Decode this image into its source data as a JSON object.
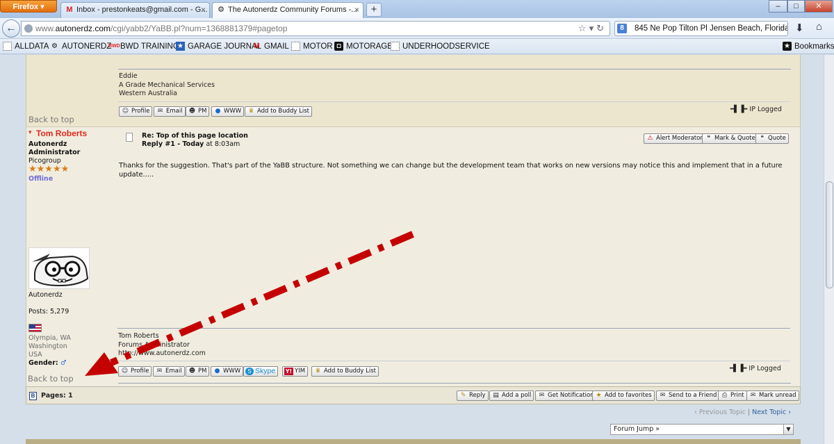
{
  "browser": {
    "menu_button": "Firefox ▾",
    "tabs": [
      {
        "label": "Inbox - prestonkeats@gmail.com - G...",
        "icon": "gmail-icon"
      },
      {
        "label": "The Autonerdz Community Forums -...",
        "icon": "autonerdz-icon"
      }
    ],
    "new_tab": "+",
    "window_buttons": {
      "minimize": "–",
      "maximize": "□",
      "close": "✕"
    },
    "url_prefix": "www.",
    "url_domain": "autonerdz.com",
    "url_path": "/cgi/yabb2/YaBB.pl?num=1368881379#pagetop",
    "search_text": "845 Ne Pop Tilton Pl Jensen Beach, Florida",
    "bookmarks_menu": "Bookmarks",
    "bookmarks": [
      {
        "label": "ALLDATA",
        "icon": "page-icon"
      },
      {
        "label": "AUTONERDZ",
        "icon": "autonerdz-icon"
      },
      {
        "label": "BWD TRAINING",
        "icon": "bwd-icon"
      },
      {
        "label": "GARAGE JOURNAL",
        "icon": "star-icon"
      },
      {
        "label": "GMAIL",
        "icon": "gmail-icon"
      },
      {
        "label": "MOTOR",
        "icon": "page-icon"
      },
      {
        "label": "MOTORAGE",
        "icon": "motorage-icon"
      },
      {
        "label": "UNDERHOODSERVICE",
        "icon": "page-icon"
      }
    ]
  },
  "previous_post": {
    "signature": "Eddie\nA Grade Mechanical Services\nWestern Australia",
    "back_to_top": "Back to top",
    "ip_logged": "IP Logged",
    "buttons": [
      "Profile",
      "Email",
      "PM",
      "WWW",
      "Add to Buddy List"
    ]
  },
  "post": {
    "author": "Tom Roberts",
    "author_title": "Autonerdz",
    "author_role": "Administrator",
    "group": "Picogroup",
    "stars": "★★★★★",
    "status": "Offline",
    "avatar_caption": "Autonerdz",
    "posts": "Posts: 5,279",
    "location": [
      "Olympia, WA",
      "Washington",
      "USA"
    ],
    "gender_label": "Gender:",
    "gender_symbol": "♂",
    "subject": "Re: Top of this page location",
    "reply_label": "Reply #1 - Today",
    "reply_time": " at 8:03am",
    "body": "Thanks for the suggestion.  That's part of the YaBB structure.  Not something we can change but the development team that works on new versions may notice this and implement that in a future update.....",
    "actions": [
      "Alert Moderator",
      "Mark & Quote",
      "Quote"
    ],
    "signature": "Tom Roberts\nForums Administrator\nhttp://www.autonerdz.com",
    "back_to_top": "Back to top",
    "ip_logged": "IP Logged",
    "buttons": [
      "Profile",
      "Email",
      "PM",
      "WWW",
      "Skype",
      "YIM",
      "Add to Buddy List"
    ]
  },
  "thread": {
    "pages_label": "Pages: 1",
    "actions": [
      "Reply",
      "Add a poll",
      "Get Notification",
      "Add to favorites",
      "Send to a Friend",
      "Print",
      "Mark unread"
    ],
    "prev_topic": "‹ Previous Topic",
    "separator": " | ",
    "next_topic": "Next Topic ›",
    "forum_jump": "Forum Jump »"
  },
  "colors": {
    "annotation_arrow": "#c40000",
    "author_name": "#e0281c"
  }
}
